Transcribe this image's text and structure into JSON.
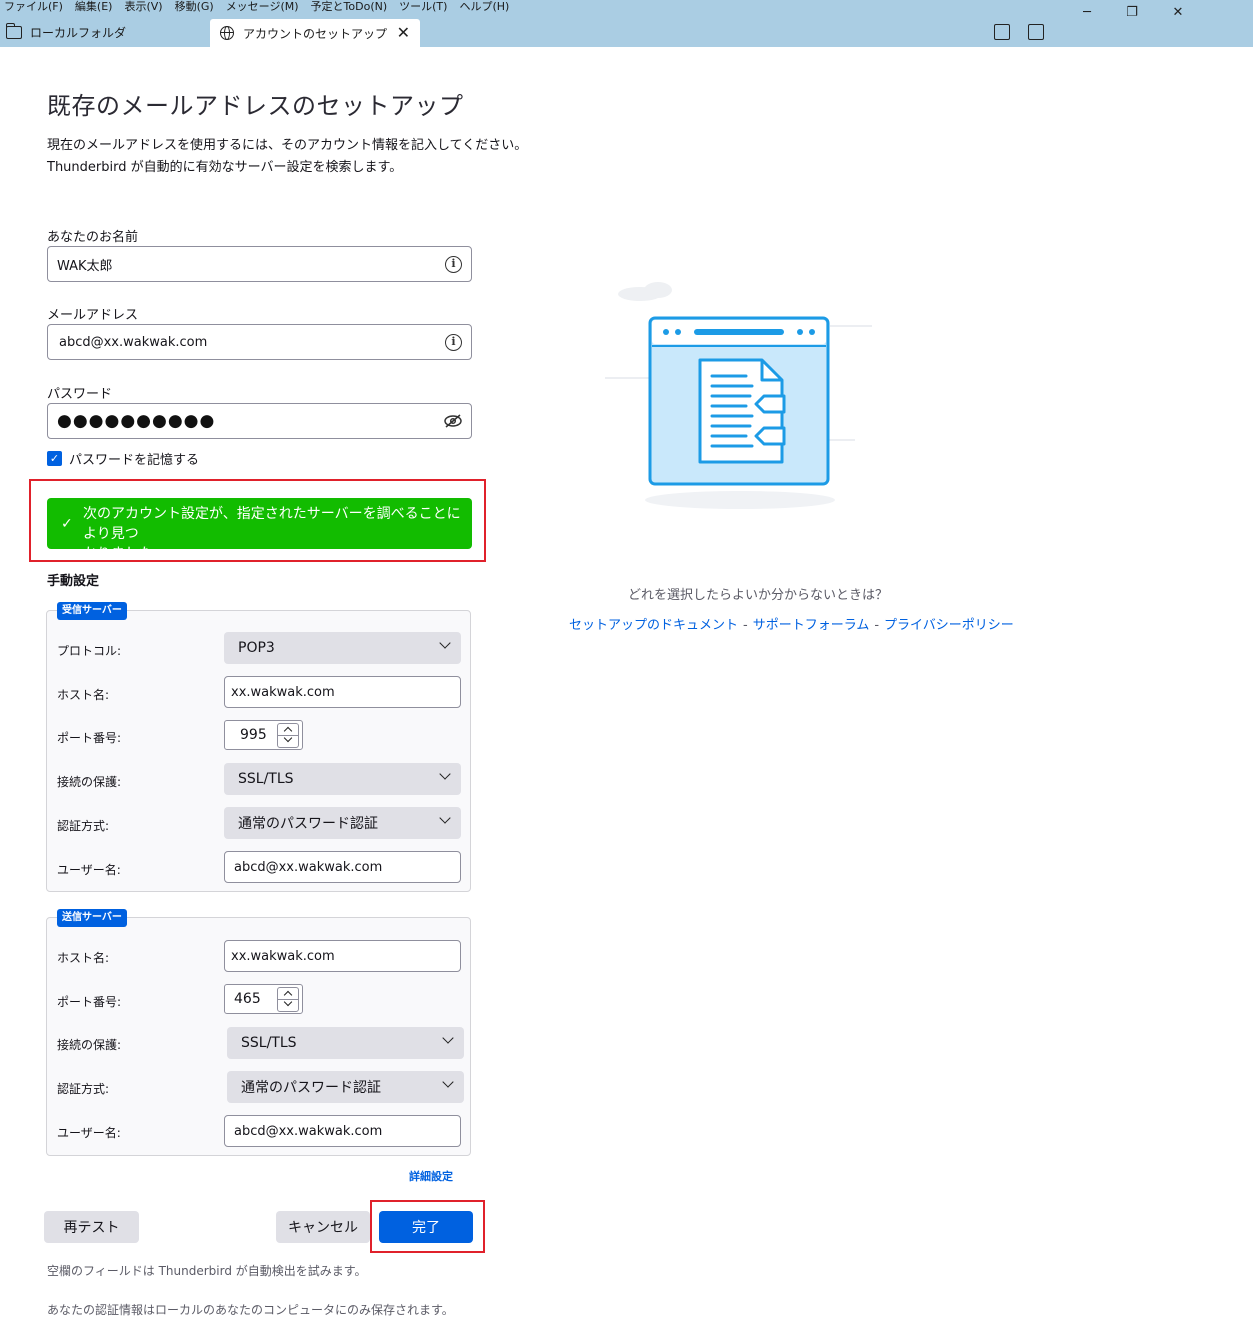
{
  "menu": [
    "ファイル(F)",
    "編集(E)",
    "表示(V)",
    "移動(G)",
    "メッセージ(M)",
    "予定とToDo(N)",
    "ツール(T)",
    "ヘルプ(H)"
  ],
  "window_controls": {
    "minimize": "─",
    "restore": "❐",
    "close": "✕"
  },
  "tabs": {
    "folder_tab": "ローカルフォルダ",
    "active_tab": "アカウントのセットアップ",
    "close": "✕"
  },
  "page": {
    "title": "既存のメールアドレスのセットアップ",
    "desc_line1": "現在のメールアドレスを使用するには、そのアカウント情報を記入してください。",
    "desc_line2": "Thunderbird が自動的に有効なサーバー設定を検索します。"
  },
  "form": {
    "name_label": "あなたのお名前",
    "name_value": "WAK太郎",
    "email_label": "メールアドレス",
    "email_value": "abcd@xx.wakwak.com",
    "password_label": "パスワード",
    "password_dots": "●●●●●●●●●●",
    "remember_label": "パスワードを記憶する",
    "remember_checked": true
  },
  "notice": {
    "line1": "次のアカウント設定が、指定されたサーバーを調べることにより見つ",
    "line2": "かりました:"
  },
  "manual": {
    "title": "手動設定",
    "incoming": {
      "badge": "受信サーバー",
      "protocol_label": "プロトコル:",
      "protocol_value": "POP3",
      "host_label": "ホスト名:",
      "host_value": "xx.wakwak.com",
      "port_label": "ポート番号:",
      "port_value": "995",
      "security_label": "接続の保護:",
      "security_value": "SSL/TLS",
      "auth_label": "認証方式:",
      "auth_value": "通常のパスワード認証",
      "user_label": "ユーザー名:",
      "user_value": "abcd@xx.wakwak.com"
    },
    "outgoing": {
      "badge": "送信サーバー",
      "host_label": "ホスト名:",
      "host_value": "xx.wakwak.com",
      "port_label": "ポート番号:",
      "port_value": "465",
      "security_label": "接続の保護:",
      "security_value": "SSL/TLS",
      "auth_label": "認証方式:",
      "auth_value": "通常のパスワード認証",
      "user_label": "ユーザー名:",
      "user_value": "abcd@xx.wakwak.com"
    },
    "advanced_link": "詳細設定"
  },
  "buttons": {
    "retest": "再テスト",
    "cancel": "キャンセル",
    "done": "完了"
  },
  "footer": {
    "line1": "空欄のフィールドは Thunderbird が自動検出を試みます。",
    "line2": "あなたの認証情報はローカルのあなたのコンピュータにのみ保存されます。"
  },
  "help": {
    "question": "どれを選択したらよいか分からないときは？",
    "link_docs": "セットアップのドキュメント",
    "link_forum": "サポートフォーラム",
    "link_privacy": "プライバシーポリシー",
    "separator": "-"
  },
  "colors": {
    "accent": "#0061e0",
    "success": "#12bc00",
    "highlight_frame": "#e0212b",
    "titlebar": "#aacde3"
  }
}
